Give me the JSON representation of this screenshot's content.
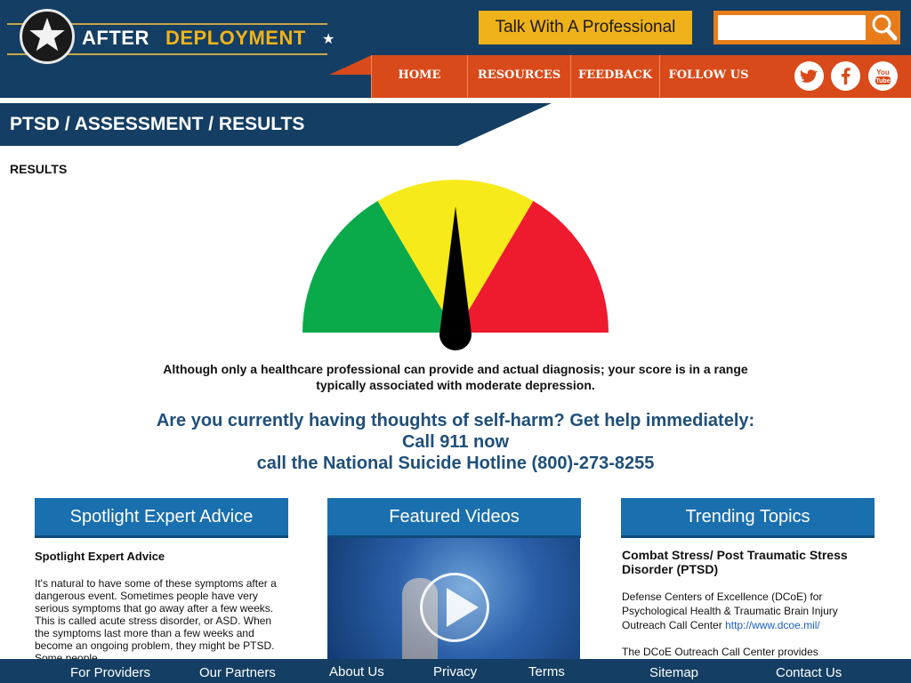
{
  "header": {
    "logo_after": "AFTER",
    "logo_deployment": "DEPLOYMENT",
    "talk_button": "Talk With A Professional",
    "search_placeholder": ""
  },
  "nav": {
    "items": [
      {
        "label": "HOME"
      },
      {
        "label": "RESOURCES"
      },
      {
        "label": "FEEDBACK"
      },
      {
        "label": "FOLLOW US"
      }
    ],
    "social": [
      {
        "icon": "twitter-icon",
        "glyph": "t"
      },
      {
        "icon": "facebook-icon",
        "glyph": "f"
      },
      {
        "icon": "youtube-icon",
        "glyph": "You"
      }
    ]
  },
  "breadcrumb": "PTSD / ASSESSMENT / RESULTS",
  "results_label": "RESULTS",
  "gauge": {
    "level": "moderate",
    "colors": {
      "low": "#0aaa4a",
      "mid": "#f6ea1a",
      "high": "#ee1a2e"
    }
  },
  "diagnosis_text_line1": "Although only a healthcare professional can provide and actual diagnosis; your score is in a range",
  "diagnosis_text_line2": "typically associated with moderate depression.",
  "help": {
    "line1": "Are you currently having thoughts of self-harm? Get help immediately:",
    "line2": "Call 911 now",
    "line3": "call the National Suicide Hotline (800)-273-8255"
  },
  "panels": {
    "spotlight": {
      "heading": "Spotlight Expert Advice",
      "title": "Spotlight Expert Advice",
      "body": "It's natural to have some of these symptoms after a dangerous event. Sometimes people have very serious symptoms that go away after a few weeks. This is called acute stress disorder, or ASD. When the symptoms last more than a few weeks and become an ongoing problem, they might be PTSD. Some people"
    },
    "videos": {
      "heading": "Featured Videos"
    },
    "trending": {
      "heading": "Trending Topics",
      "title": "Combat Stress/ Post Traumatic Stress Disorder (PTSD)",
      "body": "Defense Centers of Excellence (DCoE) for Psychological Health & Traumatic Brain Injury Outreach Call Center",
      "link": "http://www.dcoe.mil/",
      "body2": "The DCoE Outreach Call Center provides"
    }
  },
  "footer": {
    "items": [
      "For Providers",
      "Our Partners",
      "About Us",
      "Privacy",
      "Terms",
      "Sitemap",
      "Contact Us"
    ]
  }
}
